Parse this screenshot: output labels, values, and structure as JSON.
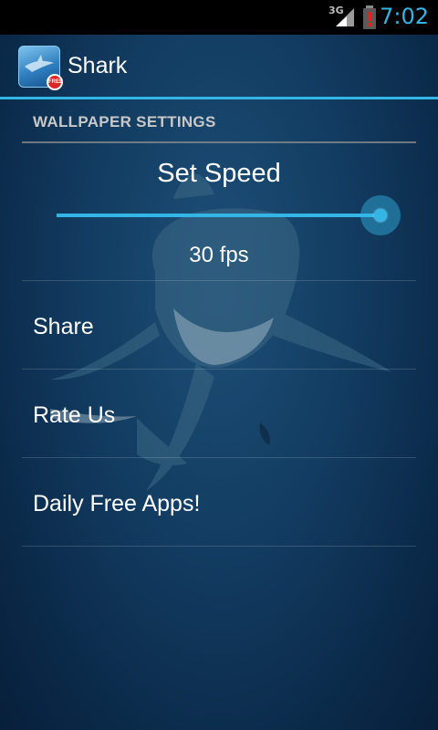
{
  "status_bar": {
    "network": "3G",
    "time": "7:02"
  },
  "action_bar": {
    "title": "Shark",
    "icon_badge": "FREE",
    "icon": "shark-app-icon"
  },
  "settings": {
    "section_header": "WALLPAPER SETTINGS",
    "speed": {
      "title": "Set Speed",
      "value_label": "30 fps",
      "slider_value": 1.0
    },
    "items": [
      {
        "label": "Share"
      },
      {
        "label": "Rate Us"
      },
      {
        "label": "Daily Free Apps!"
      }
    ]
  },
  "colors": {
    "accent": "#33b5e5",
    "status_bar": "#000000",
    "background": "#0a2a4a"
  }
}
